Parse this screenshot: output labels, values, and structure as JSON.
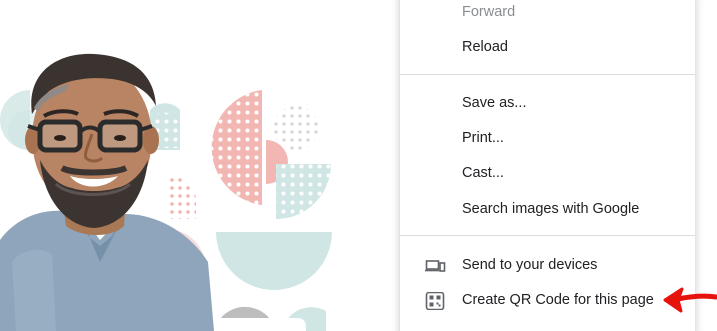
{
  "context_menu": {
    "items": [
      {
        "id": "forward",
        "label": "Forward",
        "disabled": true
      },
      {
        "id": "reload",
        "label": "Reload"
      },
      {
        "id": "save-as",
        "label": "Save as..."
      },
      {
        "id": "print",
        "label": "Print..."
      },
      {
        "id": "cast",
        "label": "Cast..."
      },
      {
        "id": "search-images",
        "label": "Search images with Google"
      },
      {
        "id": "send-to-devices",
        "label": "Send to your devices",
        "icon": "devices-icon"
      },
      {
        "id": "create-qr",
        "label": "Create QR Code for this page",
        "icon": "qr-code-icon"
      }
    ]
  },
  "annotation": {
    "icon": "red-arrow-icon",
    "color": "#e8120c"
  },
  "colors": {
    "menu_text": "#202124",
    "menu_text_disabled": "#8a8d91",
    "separator": "#dadce0",
    "pattern_pink": "#f2b7b3",
    "pattern_teal": "#cfe6e4",
    "pattern_grey": "#bdbdbd"
  }
}
